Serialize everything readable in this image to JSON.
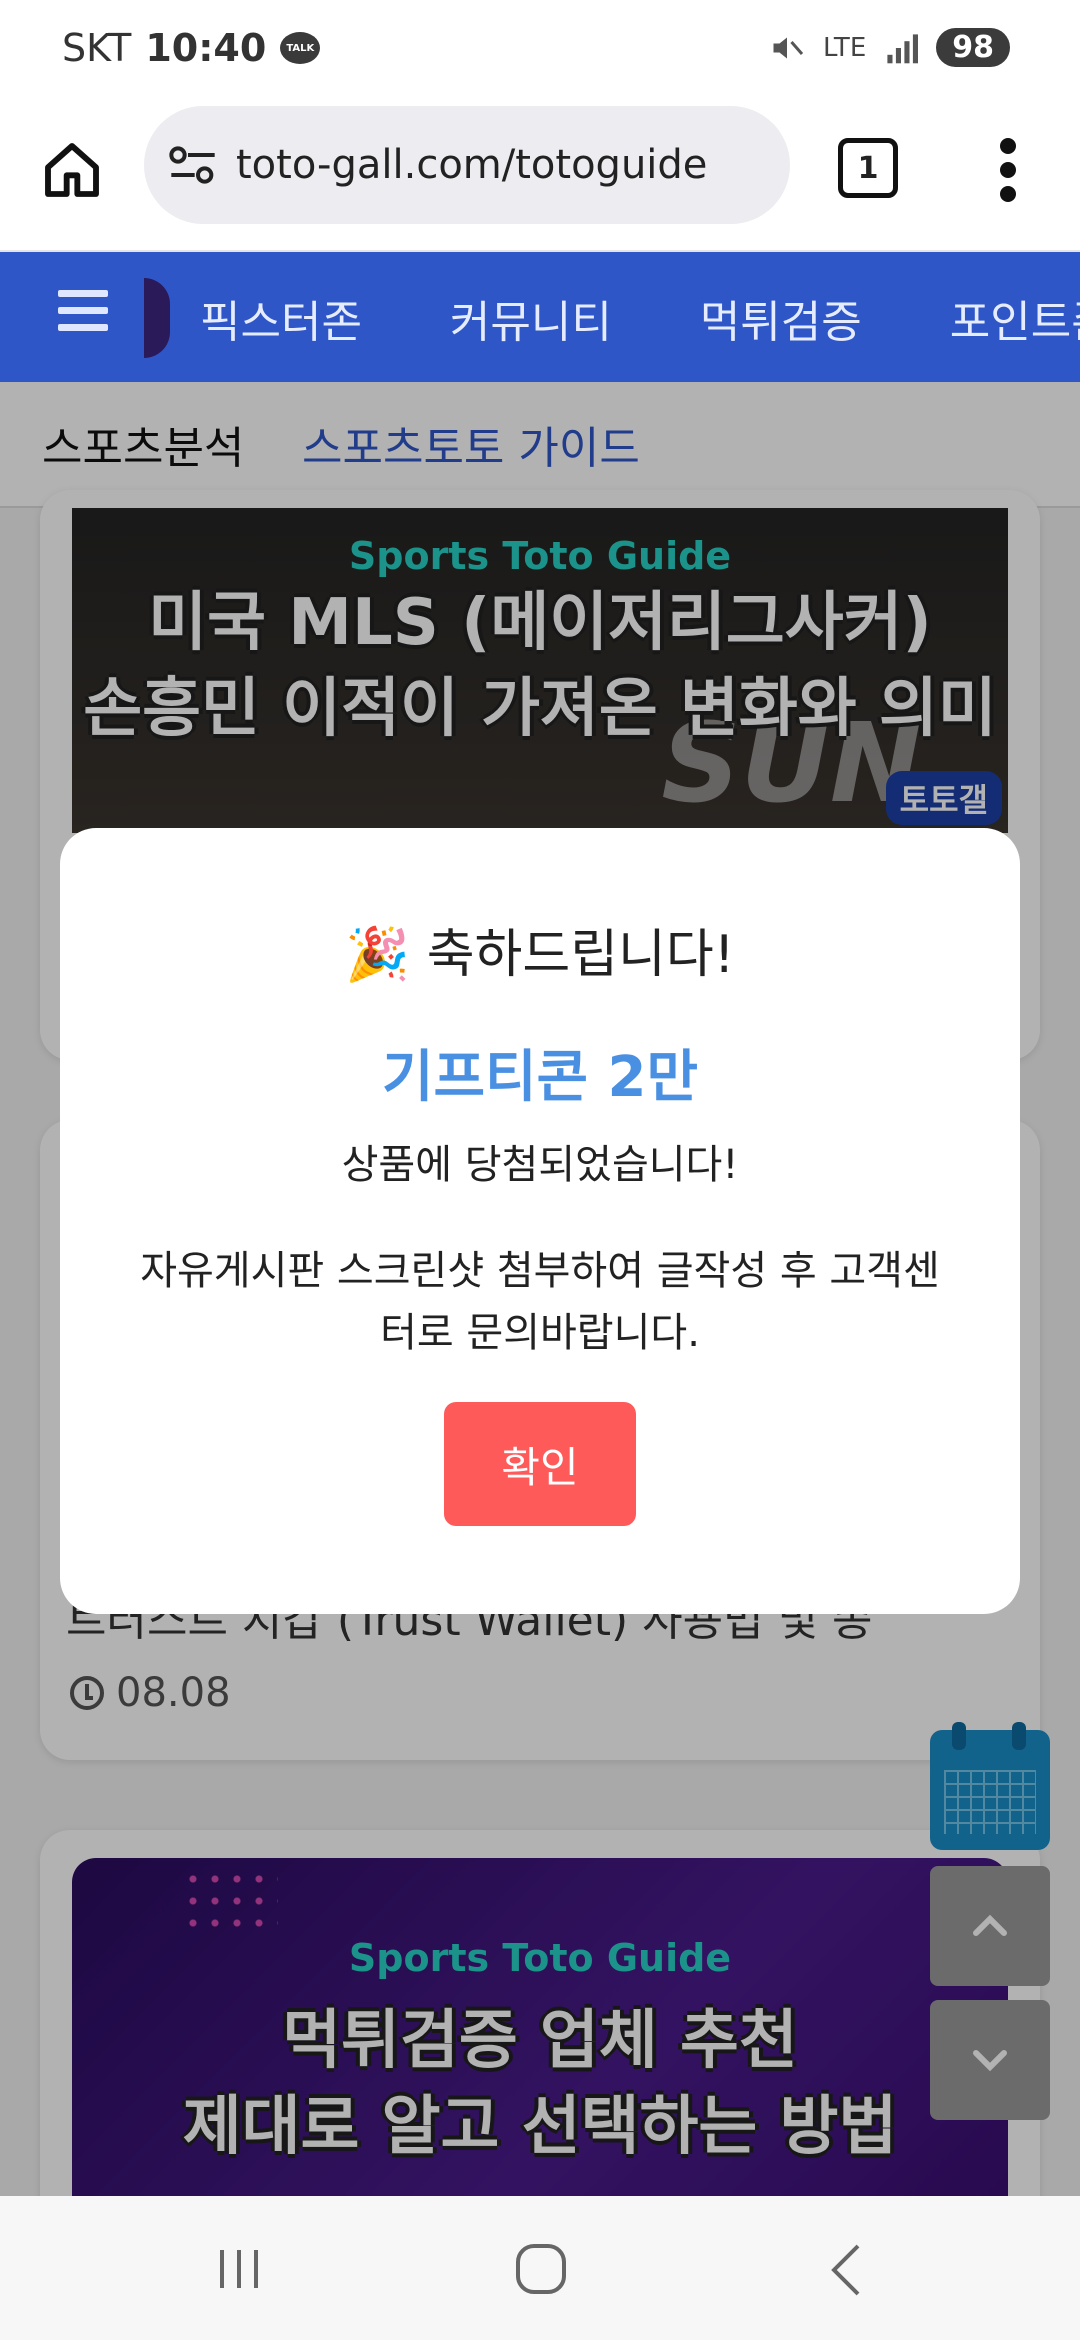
{
  "status_bar": {
    "carrier": "SKT",
    "time": "10:40",
    "talk_label": "TALK",
    "network": "LTE",
    "battery": "98"
  },
  "browser": {
    "url": "toto-gall.com/totoguide",
    "tab_count": "1"
  },
  "nav": {
    "items": [
      "픽스터존",
      "커뮤니티",
      "먹튀검증",
      "포인트존"
    ]
  },
  "subnav": {
    "items": [
      "스포츠분석",
      "스포츠토토 가이드"
    ]
  },
  "articles": [
    {
      "kicker": "Sports Toto Guide",
      "title_line1": "미국 MLS (메이저리그사커)",
      "title_line2": "손흥민 이적이 가져온 변화와 의미",
      "overlay_text": "SUN",
      "brand": "토토갤"
    },
    {
      "title_partial": "트러스트 지갑 (Trust Wallet) 사용법 및 종",
      "date": "08.08"
    },
    {
      "kicker": "Sports Toto Guide",
      "title_line1": "먹튀검증 업체 추천",
      "title_line2": "제대로 알고 선택하는 방법"
    }
  ],
  "modal": {
    "icon": "🎉",
    "title": "축하드립니다!",
    "prize": "기프티콘 2만",
    "message": "상품에 당첨되었습니다!",
    "description": "자유게시판 스크린샷 첨부하여 글작성 후 고객센터로 문의바랍니다.",
    "confirm_label": "확인"
  },
  "colors": {
    "nav_bg": "#2f56c6",
    "prize": "#4a90e2",
    "confirm_bg": "#ff5a5a"
  }
}
